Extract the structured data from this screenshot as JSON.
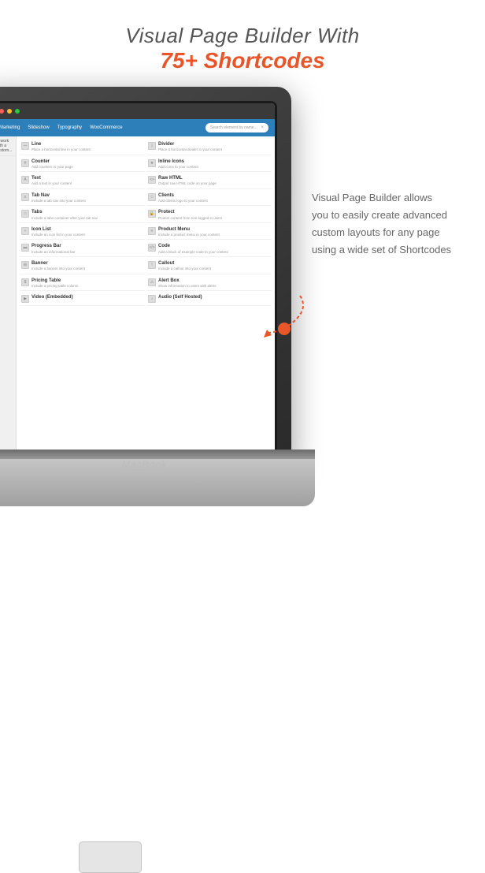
{
  "header": {
    "title_line1": "Visual Page Builder With",
    "title_line2": "75+ Shortcodes"
  },
  "laptop": {
    "brand": "MacBook"
  },
  "nav": {
    "items": [
      "Marketing",
      "Slideshow",
      "Typography",
      "WooCommerce"
    ],
    "search_placeholder": "Search element by name..."
  },
  "shortcodes": [
    {
      "name": "Line",
      "desc": "Place a horizontal line in your content",
      "icon": "—"
    },
    {
      "name": "Divider",
      "desc": "Place a horizontal divider in your content",
      "icon": "||"
    },
    {
      "name": "Counter",
      "desc": "Add counters to your page",
      "icon": "#"
    },
    {
      "name": "Inline Icons",
      "desc": "Add icons to your content",
      "icon": "★"
    },
    {
      "name": "Text",
      "desc": "Add a text in your content",
      "icon": "A"
    },
    {
      "name": "Raw HTML",
      "desc": "Output raw HTML code on your page",
      "icon": "<>"
    },
    {
      "name": "Tab Nav",
      "desc": "Include a tab nav into your content",
      "icon": "≡"
    },
    {
      "name": "Clients",
      "desc": "Add clients logo to your content",
      "icon": "☆"
    },
    {
      "name": "Tabs",
      "desc": "Include a tabs container after your tab nav",
      "icon": "□"
    },
    {
      "name": "Protect",
      "desc": "Protect content from non-logged in users",
      "icon": "🔒"
    },
    {
      "name": "Icon List",
      "desc": "Include an icon list in your content",
      "icon": "•"
    },
    {
      "name": "Product Menu",
      "desc": "Include a product menu in your content",
      "icon": "≡"
    },
    {
      "name": "Progress Bar",
      "desc": "Include an informational bar",
      "icon": "▬"
    },
    {
      "name": "Code",
      "desc": "Add a block of example code to your content",
      "icon": "<>"
    },
    {
      "name": "Banner",
      "desc": "Include a banner into your content",
      "icon": "⊞"
    },
    {
      "name": "Callout",
      "desc": "Include a callout into your content",
      "icon": "!"
    },
    {
      "name": "Pricing Table",
      "desc": "Include a pricing table column",
      "icon": "$"
    },
    {
      "name": "Alert Box",
      "desc": "Show information to users with alerts",
      "icon": "⚠"
    },
    {
      "name": "Video (Embedded)",
      "desc": "",
      "icon": "▶"
    },
    {
      "name": "Audio (Self Hosted)",
      "desc": "",
      "icon": "♪"
    }
  ],
  "side_text": {
    "line1": "Visual Page Builder allows",
    "line2": "you to easily create advanced",
    "line3": "custom layouts for any page",
    "line4": "using a wide set of Shortcodes"
  }
}
